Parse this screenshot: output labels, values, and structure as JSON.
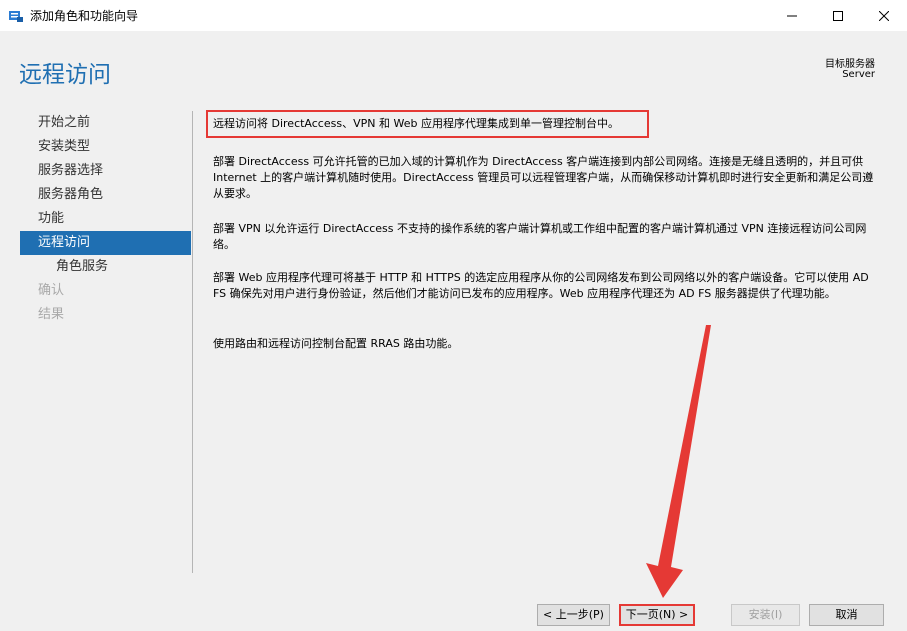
{
  "window": {
    "title": "添加角色和功能向导",
    "icon": "server-manager-icon"
  },
  "header": {
    "page_title": "远程访问",
    "destination_label": "目标服务器",
    "destination_value": "Server"
  },
  "nav": {
    "items": [
      {
        "label": "开始之前",
        "state": "normal"
      },
      {
        "label": "安装类型",
        "state": "normal"
      },
      {
        "label": "服务器选择",
        "state": "normal"
      },
      {
        "label": "服务器角色",
        "state": "normal"
      },
      {
        "label": "功能",
        "state": "normal"
      },
      {
        "label": "远程访问",
        "state": "active"
      },
      {
        "label": "角色服务",
        "state": "sub"
      },
      {
        "label": "确认",
        "state": "disabled"
      },
      {
        "label": "结果",
        "state": "disabled"
      }
    ]
  },
  "content": {
    "intro": "远程访问将 DirectAccess、VPN 和 Web 应用程序代理集成到单一管理控制台中。",
    "para_directaccess": "部署 DirectAccess 可允许托管的已加入域的计算机作为 DirectAccess 客户端连接到内部公司网络。连接是无缝且透明的，并且可供 Internet 上的客户端计算机随时使用。DirectAccess 管理员可以远程管理客户端，从而确保移动计算机即时进行安全更新和满足公司遵从要求。",
    "para_vpn": "部署 VPN 以允许运行 DirectAccess 不支持的操作系统的客户端计算机或工作组中配置的客户端计算机通过 VPN 连接远程访问公司网络。",
    "para_webproxy": "部署 Web 应用程序代理可将基于 HTTP 和 HTTPS 的选定应用程序从你的公司网络发布到公司网络以外的客户端设备。它可以使用 AD FS 确保先对用户进行身份验证，然后他们才能访问已发布的应用程序。Web 应用程序代理还为 AD FS 服务器提供了代理功能。",
    "para_rras": "使用路由和远程访问控制台配置 RRAS 路由功能。"
  },
  "footer": {
    "prev_label": "< 上一步(P)",
    "next_label": "下一页(N) >",
    "install_label": "安装(I)",
    "cancel_label": "取消"
  },
  "colors": {
    "accent": "#1f6fb2",
    "highlight_red": "#e53935",
    "panel_bg": "#f0f0f0"
  }
}
